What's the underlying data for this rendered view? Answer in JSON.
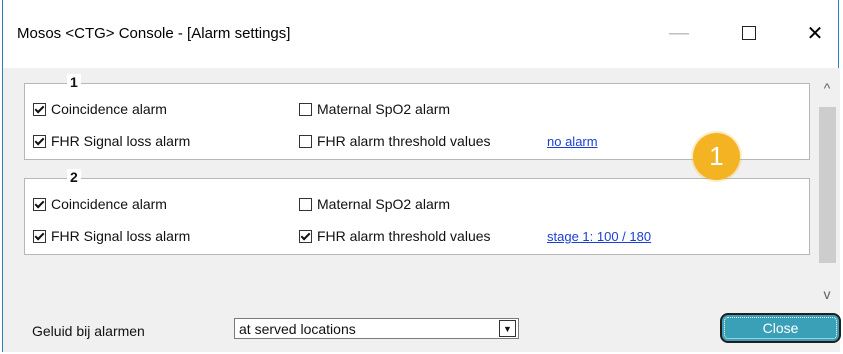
{
  "window": {
    "title": "Mosos <CTG> Console - [Alarm settings]",
    "minimize_glyph": "—",
    "close_glyph": "✕"
  },
  "groups": [
    {
      "label": "1",
      "coincidence_label": "Coincidence alarm",
      "coincidence_checked": true,
      "maternal_label": "Maternal SpO2 alarm",
      "maternal_checked": false,
      "signal_loss_label": "FHR Signal loss alarm",
      "signal_loss_checked": true,
      "threshold_label": "FHR alarm threshold values",
      "threshold_checked": false,
      "threshold_link": "no alarm"
    },
    {
      "label": "2",
      "coincidence_label": "Coincidence alarm",
      "coincidence_checked": true,
      "maternal_label": "Maternal SpO2 alarm",
      "maternal_checked": false,
      "signal_loss_label": "FHR Signal loss alarm",
      "signal_loss_checked": true,
      "threshold_label": "FHR alarm threshold values",
      "threshold_checked": true,
      "threshold_link": "stage 1: 100 / 180"
    }
  ],
  "scrollbar": {
    "up": "^",
    "down": "v"
  },
  "badge": {
    "number": "1",
    "color": "#f4b323"
  },
  "footer": {
    "sound_label": "Geluid bij alarmen",
    "select_value": "at served locations",
    "close_label": "Close"
  }
}
